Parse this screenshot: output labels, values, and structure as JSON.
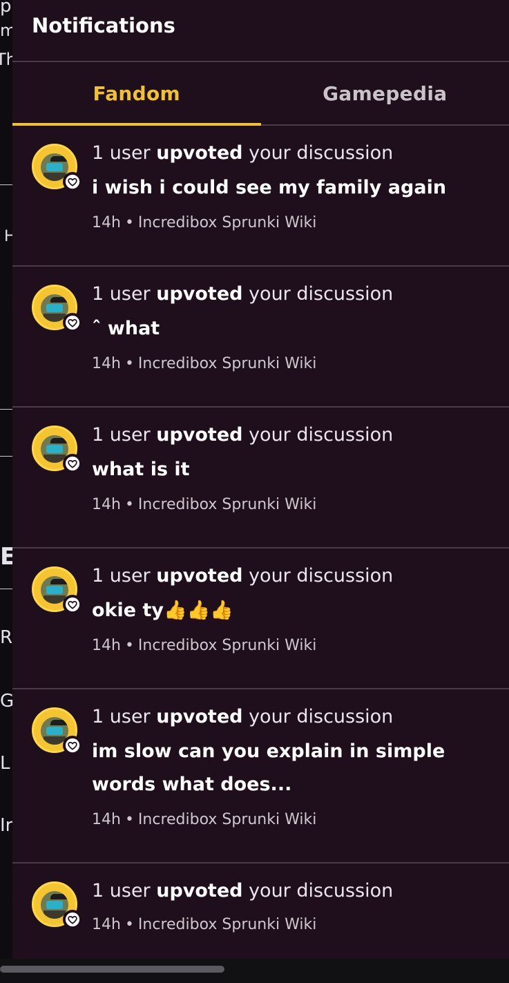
{
  "background_fragments": [
    "p",
    "m",
    "Th",
    "H",
    "E",
    "R",
    "G",
    "L",
    "Ir"
  ],
  "header": {
    "title": "Notifications"
  },
  "tabs": [
    {
      "label": "Fandom",
      "active": true
    },
    {
      "label": "Gamepedia",
      "active": false
    }
  ],
  "colors": {
    "accent": "#f2c12e",
    "panel_bg": "#1f0f1c",
    "divider": "#4a3d48"
  },
  "notifications": [
    {
      "prefix": "1 user ",
      "action": "upvoted",
      "suffix": " your discussion",
      "snippet": "i wish i could see my family again",
      "time": "14h",
      "separator": "•",
      "wiki": "Incredibox Sprunki Wiki",
      "badge_icon": "heart-icon"
    },
    {
      "prefix": "1 user ",
      "action": "upvoted",
      "suffix": " your discussion",
      "snippet": "ˆ what",
      "time": "14h",
      "separator": "•",
      "wiki": "Incredibox Sprunki Wiki",
      "badge_icon": "heart-icon"
    },
    {
      "prefix": "1 user ",
      "action": "upvoted",
      "suffix": " your discussion",
      "snippet": "what is it",
      "time": "14h",
      "separator": "•",
      "wiki": "Incredibox Sprunki Wiki",
      "badge_icon": "heart-icon"
    },
    {
      "prefix": "1 user ",
      "action": "upvoted",
      "suffix": " your discussion",
      "snippet": "okie ty👍👍👍",
      "time": "14h",
      "separator": "•",
      "wiki": "Incredibox Sprunki Wiki",
      "badge_icon": "heart-icon"
    },
    {
      "prefix": "1 user ",
      "action": "upvoted",
      "suffix": " your discussion",
      "snippet": "im slow can you explain in simple words what does...",
      "time": "14h",
      "separator": "•",
      "wiki": "Incredibox Sprunki Wiki",
      "badge_icon": "heart-icon"
    },
    {
      "prefix": "1 user ",
      "action": "upvoted",
      "suffix": " your discussion",
      "snippet": "",
      "time": "14h",
      "separator": "•",
      "wiki": "Incredibox Sprunki Wiki",
      "badge_icon": "heart-icon"
    }
  ]
}
